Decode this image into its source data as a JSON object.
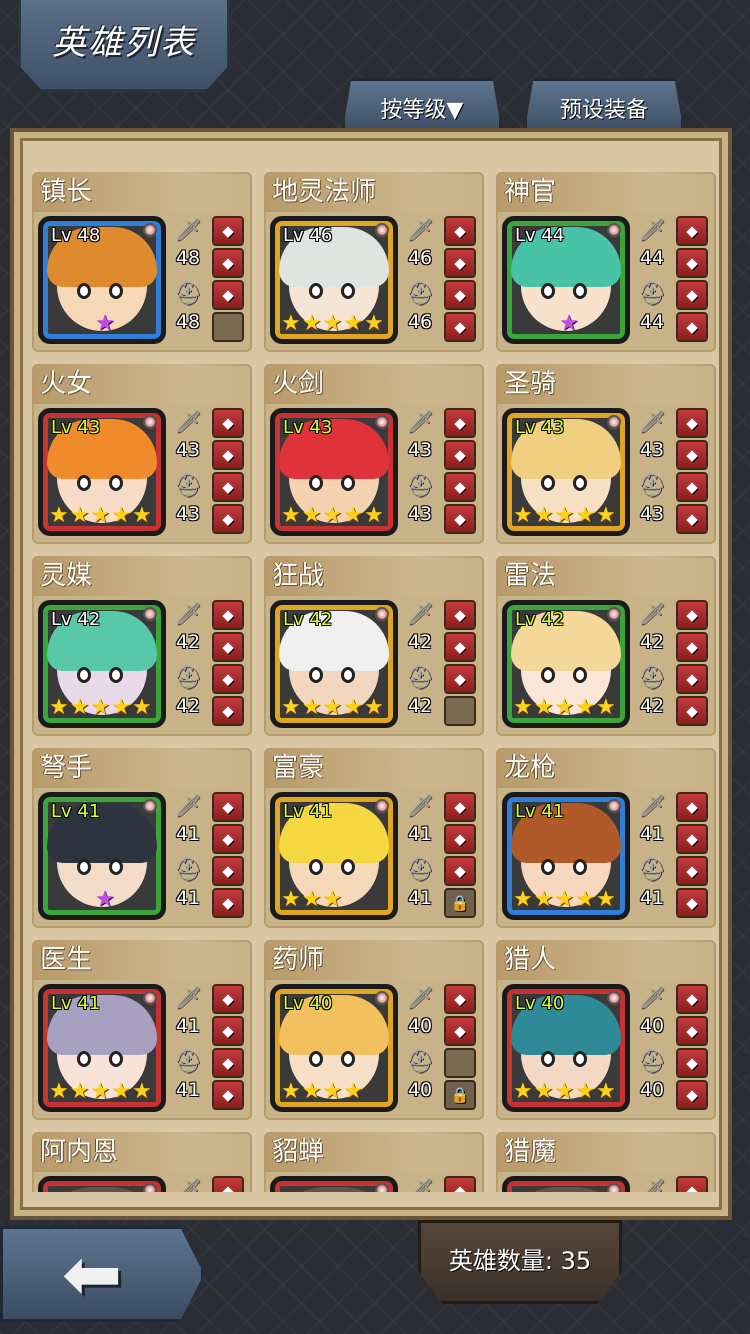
{
  "header": {
    "title": "英雄列表"
  },
  "tabs": {
    "sort_label": "按等级▼",
    "preset_label": "预设装备"
  },
  "footer": {
    "count_label": "英雄数量: 35",
    "back_icon": "back-arrow-icon"
  },
  "heroes": [
    {
      "name": "镇长",
      "level": "Lv 48",
      "level_hi": false,
      "atk": "48",
      "def": "48",
      "frame": "blue",
      "hair": "#e08a30",
      "skin": "#f6d8b8",
      "stars": 1,
      "star_color": "purple",
      "equip": [
        "filled",
        "filled",
        "filled",
        "empty"
      ]
    },
    {
      "name": "地灵法师",
      "level": "Lv 46",
      "level_hi": false,
      "atk": "46",
      "def": "46",
      "frame": "gold",
      "hair": "#dfe4e0",
      "skin": "#f3e4d4",
      "stars": 5,
      "star_color": "gold",
      "equip": [
        "filled",
        "filled",
        "filled",
        "filled"
      ]
    },
    {
      "name": "神官",
      "level": "Lv 44",
      "level_hi": false,
      "atk": "44",
      "def": "44",
      "frame": "green",
      "hair": "#49c3a8",
      "skin": "#f8e2cc",
      "stars": 1,
      "star_color": "purple",
      "equip": [
        "filled",
        "filled",
        "filled",
        "filled"
      ]
    },
    {
      "name": "火女",
      "level": "Lv 43",
      "level_hi": true,
      "atk": "43",
      "def": "43",
      "frame": "red",
      "hair": "#f08a2a",
      "skin": "#f8dcc8",
      "stars": 5,
      "star_color": "gold",
      "equip": [
        "filled",
        "filled",
        "filled",
        "filled"
      ]
    },
    {
      "name": "火剑",
      "level": "Lv 43",
      "level_hi": true,
      "atk": "43",
      "def": "43",
      "frame": "red",
      "hair": "#e0323a",
      "skin": "#f5d2b0",
      "stars": 5,
      "star_color": "gold",
      "equip": [
        "filled",
        "filled",
        "filled",
        "filled"
      ]
    },
    {
      "name": "圣骑",
      "level": "Lv 43",
      "level_hi": true,
      "atk": "43",
      "def": "43",
      "frame": "gold",
      "hair": "#f0d080",
      "skin": "#f8e0c4",
      "stars": 5,
      "star_color": "gold",
      "equip": [
        "filled",
        "filled",
        "filled",
        "filled"
      ]
    },
    {
      "name": "灵媒",
      "level": "Lv 42",
      "level_hi": false,
      "atk": "42",
      "def": "42",
      "frame": "green",
      "hair": "#58c8a8",
      "skin": "#e8d8e8",
      "stars": 5,
      "star_color": "gold",
      "equip": [
        "filled",
        "filled",
        "filled",
        "filled"
      ]
    },
    {
      "name": "狂战",
      "level": "Lv 42",
      "level_hi": true,
      "atk": "42",
      "def": "42",
      "frame": "gold",
      "hair": "#f0f0f0",
      "skin": "#f2d6c0",
      "stars": 5,
      "star_color": "gold",
      "equip": [
        "filled",
        "filled",
        "filled",
        "empty"
      ]
    },
    {
      "name": "雷法",
      "level": "Lv 42",
      "level_hi": true,
      "atk": "42",
      "def": "42",
      "frame": "green",
      "hair": "#f3d89a",
      "skin": "#fae6d6",
      "stars": 5,
      "star_color": "gold",
      "equip": [
        "filled",
        "filled",
        "filled",
        "filled"
      ]
    },
    {
      "name": "弩手",
      "level": "Lv 41",
      "level_hi": true,
      "atk": "41",
      "def": "41",
      "frame": "green",
      "hair": "#2d3440",
      "skin": "#f3dcc8",
      "stars": 1,
      "star_color": "purple",
      "equip": [
        "filled",
        "filled",
        "filled",
        "filled"
      ]
    },
    {
      "name": "富豪",
      "level": "Lv 41",
      "level_hi": true,
      "atk": "41",
      "def": "41",
      "frame": "gold",
      "hair": "#f5d840",
      "skin": "#f4d8b8",
      "stars": 3,
      "star_color": "gold",
      "equip": [
        "filled",
        "filled",
        "filled",
        "locked"
      ]
    },
    {
      "name": "龙枪",
      "level": "Lv 41",
      "level_hi": true,
      "atk": "41",
      "def": "41",
      "frame": "blue",
      "hair": "#b05a2a",
      "skin": "#f6d6bc",
      "stars": 5,
      "star_color": "gold",
      "equip": [
        "filled",
        "filled",
        "filled",
        "filled"
      ]
    },
    {
      "name": "医生",
      "level": "Lv 41",
      "level_hi": true,
      "atk": "41",
      "def": "41",
      "frame": "red",
      "hair": "#a8a0c0",
      "skin": "#f6e2d6",
      "stars": 5,
      "star_color": "gold",
      "equip": [
        "filled",
        "filled",
        "filled",
        "filled"
      ]
    },
    {
      "name": "药师",
      "level": "Lv 40",
      "level_hi": true,
      "atk": "40",
      "def": "40",
      "frame": "gold",
      "hair": "#f3c060",
      "skin": "#f8e0c8",
      "stars": 4,
      "star_color": "gold",
      "equip": [
        "filled",
        "filled",
        "empty",
        "locked"
      ]
    },
    {
      "name": "猎人",
      "level": "Lv 40",
      "level_hi": true,
      "atk": "40",
      "def": "40",
      "frame": "red",
      "hair": "#2f8a98",
      "skin": "#f3d8c4",
      "stars": 5,
      "star_color": "gold",
      "equip": [
        "filled",
        "filled",
        "filled",
        "filled"
      ]
    },
    {
      "name": "阿内恩",
      "level": "",
      "level_hi": false,
      "atk": "",
      "def": "",
      "frame": "red",
      "hair": "#555",
      "skin": "#ccc",
      "stars": 0,
      "star_color": "gold",
      "equip": [
        "filled",
        "filled",
        "filled",
        "filled"
      ]
    },
    {
      "name": "貂蝉",
      "level": "",
      "level_hi": false,
      "atk": "",
      "def": "",
      "frame": "red",
      "hair": "#555",
      "skin": "#ccc",
      "stars": 0,
      "star_color": "gold",
      "equip": [
        "filled",
        "filled",
        "filled",
        "filled"
      ]
    },
    {
      "name": "猎魔",
      "level": "",
      "level_hi": false,
      "atk": "",
      "def": "",
      "frame": "red",
      "hair": "#555",
      "skin": "#ccc",
      "stars": 0,
      "star_color": "gold",
      "equip": [
        "filled",
        "filled",
        "filled",
        "filled"
      ]
    }
  ]
}
